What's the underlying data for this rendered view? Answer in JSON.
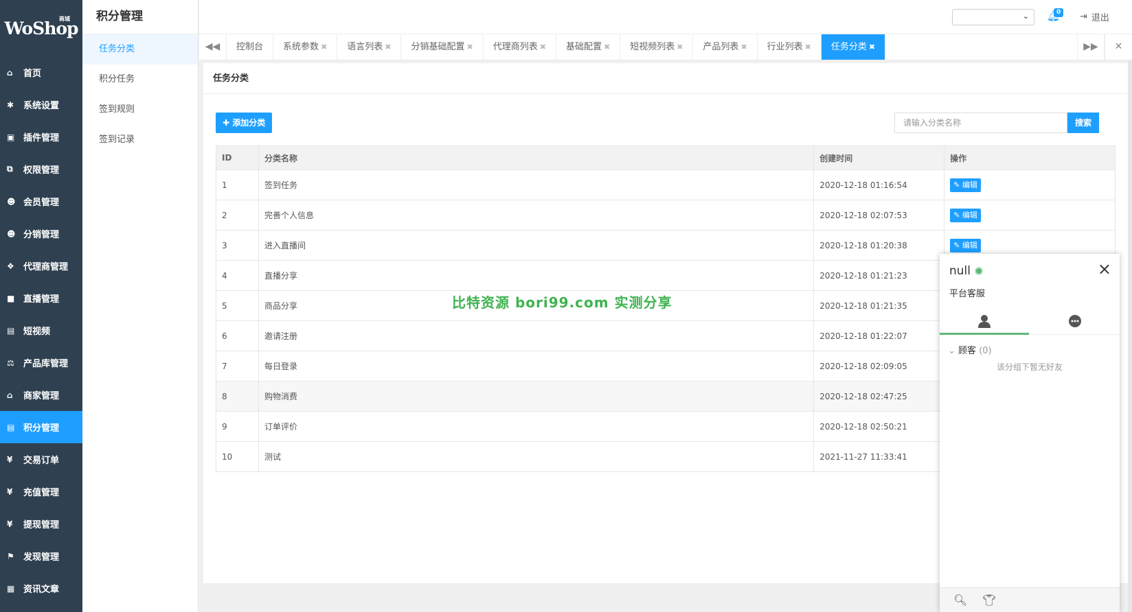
{
  "brand": {
    "logo_text": "WoShop",
    "logo_sub": "商城"
  },
  "sidebar": {
    "items": [
      {
        "label": "首页",
        "icon": "home-icon",
        "glyph": "⌂"
      },
      {
        "label": "系统设置",
        "icon": "gear-icon",
        "glyph": "✱"
      },
      {
        "label": "插件管理",
        "icon": "plugin-icon",
        "glyph": "▣"
      },
      {
        "label": "权限管理",
        "icon": "sitemap-icon",
        "glyph": "⧉"
      },
      {
        "label": "会员管理",
        "icon": "users-icon",
        "glyph": "☻"
      },
      {
        "label": "分销管理",
        "icon": "users-group-icon",
        "glyph": "☻"
      },
      {
        "label": "代理商管理",
        "icon": "cubes-icon",
        "glyph": "❖"
      },
      {
        "label": "直播管理",
        "icon": "video-camera-icon",
        "glyph": "■"
      },
      {
        "label": "短视频",
        "icon": "file-video-icon",
        "glyph": "▤"
      },
      {
        "label": "产品库管理",
        "icon": "balance-scale-icon",
        "glyph": "⚖"
      },
      {
        "label": "商家管理",
        "icon": "bank-icon",
        "glyph": "⌂"
      },
      {
        "label": "积分管理",
        "icon": "file-text-icon",
        "glyph": "▤"
      },
      {
        "label": "交易订单",
        "icon": "yen-icon",
        "glyph": "¥"
      },
      {
        "label": "充值管理",
        "icon": "yen-icon",
        "glyph": "¥"
      },
      {
        "label": "提现管理",
        "icon": "yen-icon",
        "glyph": "¥"
      },
      {
        "label": "发现管理",
        "icon": "flag-icon",
        "glyph": "⚑"
      },
      {
        "label": "资讯文章",
        "icon": "newspaper-icon",
        "glyph": "▦"
      }
    ],
    "active_index": 11
  },
  "submenu": {
    "title": "积分管理",
    "items": [
      "任务分类",
      "积分任务",
      "签到规则",
      "签到记录"
    ]
  },
  "header": {
    "select_value": "",
    "notification_count": "0",
    "logout_label": "退出"
  },
  "tabs": {
    "items": [
      "控制台",
      "系统参数",
      "语言列表",
      "分销基础配置",
      "代理商列表",
      "基础配置",
      "短视频列表",
      "产品列表",
      "行业列表",
      "任务分类"
    ]
  },
  "page": {
    "breadcrumb": "任务分类",
    "add_label": "添加分类",
    "search_placeholder": "请输入分类名称",
    "search_label": "搜索"
  },
  "table": {
    "headers": [
      "ID",
      "分类名称",
      "创建时间",
      "操作"
    ],
    "edit_label": "编辑",
    "rows": [
      {
        "id": "1",
        "name": "签到任务",
        "time": "2020-12-18 01:16:54"
      },
      {
        "id": "2",
        "name": "完善个人信息",
        "time": "2020-12-18 02:07:53"
      },
      {
        "id": "3",
        "name": "进入直播间",
        "time": "2020-12-18 01:20:38"
      },
      {
        "id": "4",
        "name": "直播分享",
        "time": "2020-12-18 01:21:23"
      },
      {
        "id": "5",
        "name": "商品分享",
        "time": "2020-12-18 01:21:35"
      },
      {
        "id": "6",
        "name": "邀请注册",
        "time": "2020-12-18 01:22:07"
      },
      {
        "id": "7",
        "name": "每日登录",
        "time": "2020-12-18 02:09:05"
      },
      {
        "id": "8",
        "name": "购物消费",
        "time": "2020-12-18 02:47:25"
      },
      {
        "id": "9",
        "name": "订单评价",
        "time": "2020-12-18 02:50:21"
      },
      {
        "id": "10",
        "name": "测试",
        "time": "2021-11-27 11:33:41"
      }
    ]
  },
  "watermark": "比特资源 bori99.com 实测分享",
  "chat": {
    "name": "null",
    "sign": "平台客服",
    "group_label": "顾客",
    "group_count": "(0)",
    "empty_text": "该分组下暂无好友"
  },
  "colors": {
    "accent": "#1e9fff",
    "sidebar": "#2f4050",
    "online": "#5fb878"
  }
}
